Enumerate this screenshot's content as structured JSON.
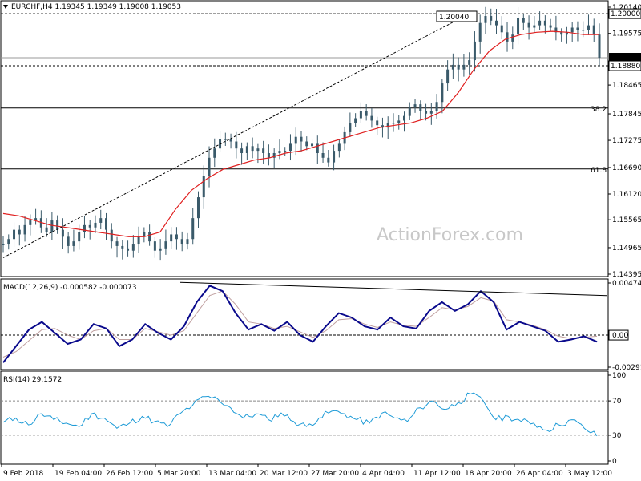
{
  "main_header": "EURCHF,H4  1.19345 1.19349 1.19008 1.19053",
  "watermark": "ActionForex.com",
  "price_axis": {
    "ticks": [
      "1.20140",
      "1.19575",
      "1.19053",
      "1.18880",
      "1.18465",
      "1.17845",
      "1.17275",
      "1.16690",
      "1.16120",
      "1.15565",
      "1.14965",
      "1.14395"
    ],
    "current_price": "1.19053",
    "highlight_level": "1.20000",
    "box_level": "1.18880"
  },
  "annotations": {
    "peak_label": "1.20040",
    "fib_382": "38.2",
    "fib_618": "61.8"
  },
  "macd_header": "MACD(12,26,9) -0.000582 -0.000073",
  "macd_axis": [
    "0.004745",
    "0.00",
    "-0.002913"
  ],
  "macd_zero_box": "0.00",
  "rsi_header": "RSI(14) 29.1572",
  "rsi_axis": [
    "100",
    "70",
    "30",
    "0"
  ],
  "time_labels": [
    "9 Feb 2018",
    "19 Feb 04:00",
    "26 Feb 12:00",
    "5 Mar 20:00",
    "13 Mar 04:00",
    "20 Mar 12:00",
    "27 Mar 20:00",
    "4 Apr 04:00",
    "11 Apr 12:00",
    "18 Apr 20:00",
    "26 Apr 04:00",
    "3 May 12:00"
  ],
  "colors": {
    "candle": "#3a5a6a",
    "ma": "#e02020",
    "macd": "#0a0a8c",
    "signal": "#c0a0a0",
    "rsi": "#1e9bd7",
    "grid": "#000000"
  },
  "chart_data": {
    "type": "line",
    "title": "EURCHF,H4",
    "price": {
      "ylim": [
        1.14395,
        1.2014
      ],
      "ohlc_last": {
        "open": 1.19345,
        "high": 1.19349,
        "low": 1.19008,
        "close": 1.19053
      },
      "levels": [
        1.2,
        1.1888
      ],
      "fib_levels": [
        {
          "label": "38.2",
          "value": 1.1797
        },
        {
          "label": "61.8",
          "value": 1.1666
        }
      ],
      "close_series": [
        1.1505,
        1.1515,
        1.1535,
        1.1525,
        1.1545,
        1.1555,
        1.156,
        1.154,
        1.153,
        1.1555,
        1.1535,
        1.152,
        1.15,
        1.151,
        1.153,
        1.1545,
        1.154,
        1.155,
        1.156,
        1.1535,
        1.151,
        1.15,
        1.1495,
        1.149,
        1.1505,
        1.152,
        1.153,
        1.151,
        1.149,
        1.1495,
        1.151,
        1.1525,
        1.1515,
        1.1505,
        1.1515,
        1.156,
        1.1605,
        1.165,
        1.169,
        1.171,
        1.173,
        1.173,
        1.1725,
        1.171,
        1.17,
        1.1715,
        1.1705,
        1.171,
        1.17,
        1.169,
        1.17,
        1.1705,
        1.1705,
        1.172,
        1.1735,
        1.1725,
        1.1715,
        1.172,
        1.17,
        1.169,
        1.168,
        1.1705,
        1.172,
        1.1745,
        1.1765,
        1.1775,
        1.179,
        1.178,
        1.177,
        1.176,
        1.1755,
        1.1765,
        1.1765,
        1.177,
        1.178,
        1.18,
        1.1805,
        1.179,
        1.1785,
        1.179,
        1.181,
        1.185,
        1.188,
        1.189,
        1.188,
        1.189,
        1.19,
        1.194,
        1.198,
        1.1995,
        1.1985,
        1.1975,
        1.196,
        1.194,
        1.1955,
        1.199,
        1.198,
        1.197,
        1.1975,
        1.1985,
        1.1975,
        1.197,
        1.196,
        1.1955,
        1.196,
        1.197,
        1.1965,
        1.1965,
        1.1975,
        1.1955,
        1.19053
      ],
      "ma_series": [
        1.157,
        1.1565,
        1.1555,
        1.1545,
        1.154,
        1.1535,
        1.153,
        1.1525,
        1.152,
        1.152,
        1.153,
        1.158,
        1.162,
        1.1645,
        1.1665,
        1.1675,
        1.1685,
        1.169,
        1.17,
        1.1705,
        1.1715,
        1.1725,
        1.1735,
        1.1745,
        1.1755,
        1.176,
        1.1765,
        1.1775,
        1.179,
        1.183,
        1.188,
        1.192,
        1.1945,
        1.1955,
        1.196,
        1.1962,
        1.196,
        1.1955,
        1.1955
      ]
    },
    "macd": {
      "ylim": [
        -0.002913,
        0.004745
      ],
      "macd": [
        -0.0025,
        -0.001,
        0.0005,
        0.0012,
        0.0002,
        -0.0008,
        -0.0004,
        0.001,
        0.0006,
        -0.001,
        -0.0004,
        0.001,
        0.0002,
        -0.0004,
        0.0008,
        0.003,
        0.0045,
        0.004,
        0.002,
        0.0005,
        0.001,
        0.0004,
        0.0012,
        0.0,
        -0.0006,
        0.0008,
        0.002,
        0.0016,
        0.0008,
        0.0005,
        0.0016,
        0.0008,
        0.0006,
        0.0022,
        0.003,
        0.0022,
        0.0028,
        0.004,
        0.003,
        0.0005,
        0.0012,
        0.0008,
        0.0004,
        -0.0006,
        -0.0004,
        -0.0001,
        -0.0006
      ],
      "signal": [
        -0.002,
        -0.0015,
        -0.0005,
        0.0005,
        0.0006,
        0.0,
        -0.0004,
        0.0004,
        0.0006,
        -0.0004,
        -0.0004,
        0.0006,
        0.0003,
        0.0,
        0.0004,
        0.002,
        0.0036,
        0.004,
        0.0028,
        0.0012,
        0.001,
        0.0006,
        0.0008,
        0.0003,
        -0.0002,
        0.0004,
        0.0014,
        0.0015,
        0.001,
        0.0007,
        0.0012,
        0.0009,
        0.0008,
        0.0016,
        0.0025,
        0.0023,
        0.0026,
        0.0034,
        0.0031,
        0.0014,
        0.0012,
        0.0009,
        0.0005,
        -0.0001,
        -0.0003,
        -0.0002,
        -0.0001
      ],
      "trendline": [
        0.0048,
        0.0036
      ]
    },
    "rsi": {
      "ylim": [
        0,
        100
      ],
      "levels": [
        70,
        30
      ],
      "values": [
        45,
        50,
        42,
        55,
        48,
        44,
        40,
        55,
        50,
        38,
        44,
        52,
        46,
        40,
        55,
        65,
        75,
        72,
        62,
        50,
        55,
        48,
        56,
        46,
        40,
        50,
        58,
        55,
        48,
        44,
        56,
        50,
        46,
        62,
        70,
        60,
        68,
        78,
        70,
        48,
        52,
        46,
        44,
        36,
        42,
        48,
        38,
        29.1572
      ]
    },
    "xlabels": [
      "9 Feb 2018",
      "19 Feb 04:00",
      "26 Feb 12:00",
      "5 Mar 20:00",
      "13 Mar 04:00",
      "20 Mar 12:00",
      "27 Mar 20:00",
      "4 Apr 04:00",
      "11 Apr 12:00",
      "18 Apr 20:00",
      "26 Apr 04:00",
      "3 May 12:00"
    ]
  }
}
